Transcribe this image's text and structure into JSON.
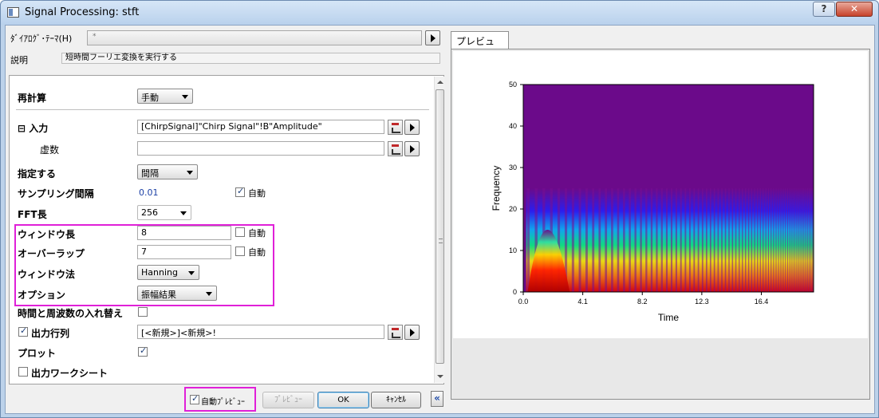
{
  "window": {
    "title": "Signal Processing: stft",
    "help_label": "?",
    "close_label": "✕"
  },
  "header": {
    "theme_label": "ﾀﾞｲｱﾛｸﾞ･ﾃｰﾏ(H)",
    "theme_value": "*",
    "desc_label": "説明",
    "desc_value": "短時間フーリエ変換を実行する"
  },
  "form": {
    "recalc_label": "再計算",
    "recalc_value": "手動",
    "input_label": "⊟ 入力",
    "input_value": "[ChirpSignal]\"Chirp Signal\"!B\"Amplitude\"",
    "imag_label": "虚数",
    "imag_value": "",
    "specify_label": "指定する",
    "specify_value": "間隔",
    "sampling_label": "サンプリング間隔",
    "sampling_value": "0.01",
    "sampling_auto": "自動",
    "fft_label": "FFT長",
    "fft_value": "256",
    "window_len_label": "ウィンドウ長",
    "window_len_value": "8",
    "window_len_auto": "自動",
    "overlap_label": "オーバーラップ",
    "overlap_value": "7",
    "overlap_auto": "自動",
    "window_method_label": "ウィンドウ法",
    "window_method_value": "Hanning",
    "option_label": "オプション",
    "option_value": "振幅結果",
    "swap_label": "時間と周波数の入れ替え",
    "output_matrix_label": "出力行列",
    "output_matrix_value": "[<新規>]<新規>!",
    "plot_label": "プロット",
    "output_sheet_label": "出力ワークシート"
  },
  "footer": {
    "auto_preview_label": "自動ﾌﾟﾚﾋﾞｭｰ",
    "preview_label": "ﾌﾟﾚﾋﾞｭｰ",
    "ok_label": "OK",
    "cancel_label": "ｷｬﾝｾﾙ",
    "collapse_label": "«"
  },
  "preview": {
    "tab_label": "プレビュー"
  },
  "chart_data": {
    "type": "heatmap",
    "title": "",
    "xlabel": "Time",
    "ylabel": "Frequency",
    "xlim": [
      0,
      20
    ],
    "ylim": [
      0,
      50
    ],
    "x_ticks": [
      "0.0",
      "4.1",
      "8.2",
      "12.3",
      "16.4"
    ],
    "y_ticks": [
      "0",
      "10",
      "20",
      "30",
      "40",
      "50"
    ],
    "colormap": [
      "#6b0a8a",
      "#2020ff",
      "#00c0ff",
      "#00ff80",
      "#ffff00",
      "#ff8000",
      "#e00000"
    ],
    "description_values": {
      "chirp_start_freq": 0,
      "band_top_freq": 25,
      "background": "#6b0a8a"
    }
  }
}
